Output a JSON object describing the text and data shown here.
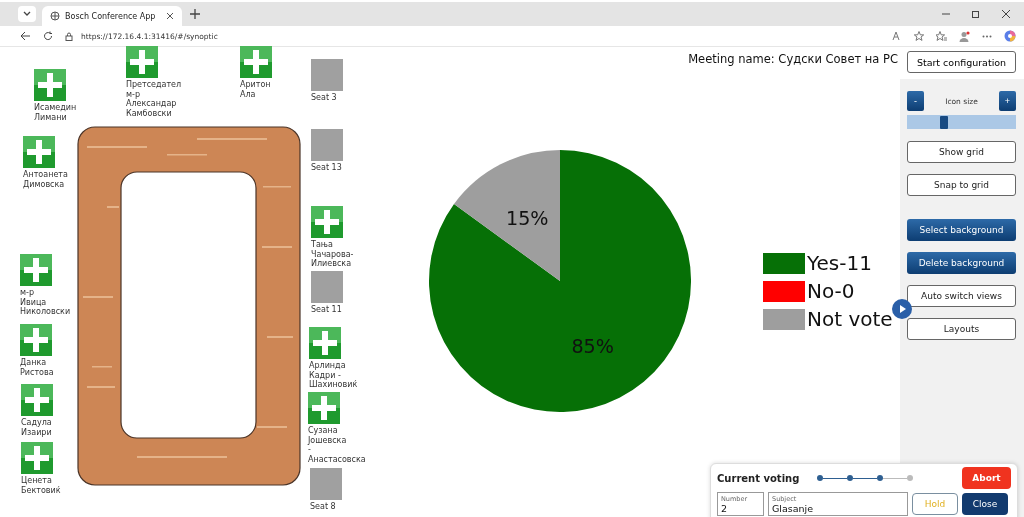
{
  "browser": {
    "tab_title": "Bosch Conference App",
    "url": "https://172.16.4.1:31416/#/synoptic"
  },
  "seats": [
    {
      "kind": "voted",
      "name": "Исамедин\nЛимани"
    },
    {
      "kind": "voted",
      "name": "Претседател\nм-р\nАлександар\nКамбовски"
    },
    {
      "kind": "voted",
      "name": "Аритон\nАла"
    },
    {
      "kind": "empty",
      "name": "Seat 3"
    },
    {
      "kind": "voted",
      "name": "Антоанета\nДимовска"
    },
    {
      "kind": "empty",
      "name": "Seat 13"
    },
    {
      "kind": "voted",
      "name": "Тања\nЧачарова-\nИлиевска"
    },
    {
      "kind": "voted",
      "name": "м-р\nИвица\nНиколовски"
    },
    {
      "kind": "empty",
      "name": "Seat 11"
    },
    {
      "kind": "voted",
      "name": "Данка\nРистова"
    },
    {
      "kind": "voted",
      "name": "Арлинда\nКадри -\nШахиновиќ"
    },
    {
      "kind": "voted",
      "name": "Садула\nИзаири"
    },
    {
      "kind": "voted",
      "name": "Сузана\nЈошевска\n-\nАнастасовска"
    },
    {
      "kind": "voted",
      "name": "Ценета\nБектовиќ"
    },
    {
      "kind": "empty",
      "name": "Seat 8"
    }
  ],
  "meeting_name": "Meeting name: Судски Совет на РС",
  "chart_data": {
    "type": "pie",
    "categories": [
      "Yes-11",
      "No-0",
      "Not vote"
    ],
    "values": [
      85,
      0,
      15
    ],
    "colors": [
      "#067006",
      "#ff0000",
      "#9e9e9e"
    ],
    "value_labels": [
      "85%",
      null,
      "15%"
    ]
  },
  "sidebar": {
    "start_button": "Start configuration",
    "minus": "-",
    "icon_size_label": "Icon size",
    "plus": "+",
    "icon_size": {
      "level": 0.34
    },
    "buttons": [
      {
        "label": "Show grid",
        "kind": "plain"
      },
      {
        "label": "Snap to grid",
        "kind": "plain"
      },
      {
        "label": "Select background",
        "kind": "primary"
      },
      {
        "label": "Delete background",
        "kind": "primary"
      },
      {
        "label": "Auto switch views",
        "kind": "plain"
      },
      {
        "label": "Layouts",
        "kind": "plain"
      }
    ]
  },
  "voting": {
    "title": "Current voting",
    "steps": [
      {
        "done": true
      },
      {
        "done": true
      },
      {
        "done": true
      },
      {
        "done": false
      }
    ],
    "abort": "Abort",
    "number_label": "Number",
    "number": "2",
    "subject_label": "Subject",
    "subject": "Glasanje",
    "hold": "Hold",
    "close": "Close"
  }
}
